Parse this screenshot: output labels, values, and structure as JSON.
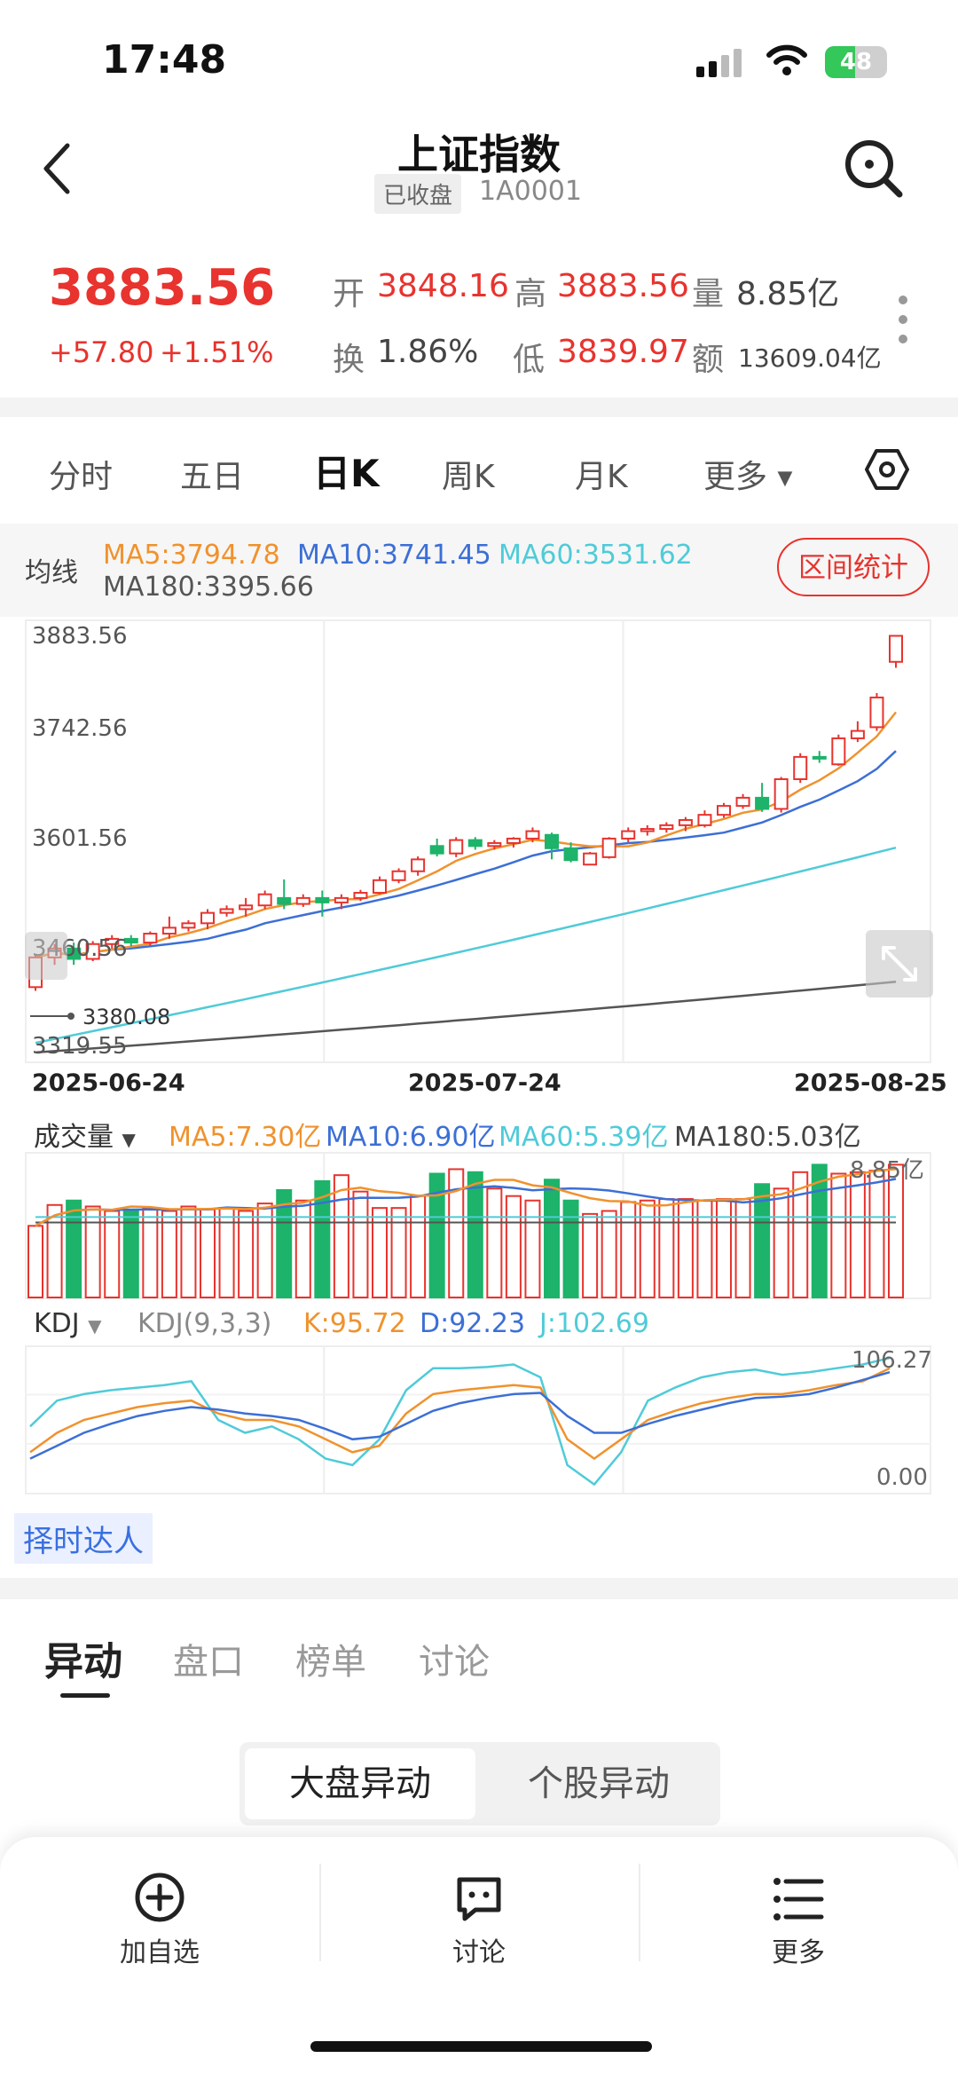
{
  "status_bar": {
    "time": "17:48",
    "battery": "48",
    "battery_level": 0.48
  },
  "header": {
    "title": "上证指数",
    "status": "已收盘",
    "code": "1A0001"
  },
  "quote": {
    "price": "3883.56",
    "change": "+57.80",
    "change_pct": "+1.51%",
    "open_label": "开",
    "open": "3848.16",
    "high_label": "高",
    "high": "3883.56",
    "volume_label": "量",
    "volume": "8.85亿",
    "turnover_label": "换",
    "turnover": "1.86%",
    "low_label": "低",
    "low": "3839.97",
    "amount_label": "额",
    "amount": "13609.04亿"
  },
  "chart_tabs": {
    "intraday": "分时",
    "five_day": "五日",
    "day_k": "日K",
    "week_k": "周K",
    "month_k": "月K",
    "more": "更多"
  },
  "ma_bar": {
    "label": "均线",
    "ma5": "MA5:3794.78",
    "ma10": "MA10:3741.45",
    "ma60": "MA60:3531.62",
    "ma180": "MA180:3395.66",
    "range_stats": "区间统计",
    "colors": {
      "ma5": "#f0922d",
      "ma10": "#3c6fd6",
      "ma60": "#4fcbd8",
      "ma180": "#555555"
    }
  },
  "volume_bar": {
    "label": "成交量",
    "ma5": "MA5:7.30亿",
    "ma10": "MA10:6.90亿",
    "ma60": "MA60:5.39亿",
    "ma180": "MA180:5.03亿",
    "last": "8.85亿"
  },
  "kdj_bar": {
    "label": "KDJ",
    "params": "KDJ(9,3,3)",
    "k": "K:95.72",
    "d": "D:92.23",
    "j": "J:102.69",
    "top": "106.27",
    "bottom": "0.00"
  },
  "badge": "择时达人",
  "bottom_tabs": [
    "异动",
    "盘口",
    "榜单",
    "讨论"
  ],
  "segment": {
    "left": "大盘异动",
    "right": "个股异动"
  },
  "bottom_bar": {
    "add": "加自选",
    "discuss": "讨论",
    "more": "更多"
  },
  "chart_data": {
    "type": "candlestick",
    "y_ticks": [
      "3883.56",
      "3742.56",
      "3601.56",
      "3460.56",
      "3319.55"
    ],
    "ylim": [
      3319.55,
      3883.56
    ],
    "low_marker": "3380.08",
    "x_labels": [
      "2025-06-24",
      "2025-07-24",
      "2025-08-25"
    ],
    "candles": [
      [
        3410,
        3450,
        3405,
        3455
      ],
      [
        3450,
        3462,
        3440,
        3468
      ],
      [
        3462,
        3448,
        3440,
        3470
      ],
      [
        3448,
        3468,
        3445,
        3472
      ],
      [
        3468,
        3475,
        3462,
        3480
      ],
      [
        3475,
        3470,
        3465,
        3480
      ],
      [
        3470,
        3482,
        3466,
        3485
      ],
      [
        3482,
        3490,
        3475,
        3505
      ],
      [
        3490,
        3496,
        3485,
        3500
      ],
      [
        3496,
        3510,
        3488,
        3515
      ],
      [
        3510,
        3515,
        3505,
        3520
      ],
      [
        3515,
        3520,
        3505,
        3530
      ],
      [
        3520,
        3535,
        3515,
        3540
      ],
      [
        3530,
        3522,
        3515,
        3555
      ],
      [
        3522,
        3530,
        3518,
        3535
      ],
      [
        3530,
        3524,
        3505,
        3540
      ],
      [
        3524,
        3530,
        3515,
        3535
      ],
      [
        3530,
        3537,
        3526,
        3541
      ],
      [
        3537,
        3554,
        3535,
        3559
      ],
      [
        3554,
        3566,
        3550,
        3570
      ],
      [
        3566,
        3582,
        3560,
        3586
      ],
      [
        3600,
        3590,
        3586,
        3610
      ],
      [
        3590,
        3608,
        3585,
        3612
      ],
      [
        3608,
        3600,
        3595,
        3612
      ],
      [
        3600,
        3604,
        3595,
        3608
      ],
      [
        3604,
        3610,
        3598,
        3612
      ],
      [
        3610,
        3620,
        3605,
        3625
      ],
      [
        3615,
        3597,
        3582,
        3618
      ],
      [
        3597,
        3581,
        3578,
        3605
      ],
      [
        3575,
        3590,
        3574,
        3592
      ],
      [
        3585,
        3610,
        3583,
        3612
      ],
      [
        3610,
        3620,
        3605,
        3625
      ],
      [
        3620,
        3623,
        3614,
        3628
      ],
      [
        3623,
        3628,
        3618,
        3632
      ],
      [
        3628,
        3635,
        3620,
        3639
      ],
      [
        3628,
        3642,
        3625,
        3648
      ],
      [
        3642,
        3654,
        3638,
        3658
      ],
      [
        3654,
        3665,
        3650,
        3670
      ],
      [
        3665,
        3650,
        3646,
        3685
      ],
      [
        3650,
        3690,
        3645,
        3693
      ],
      [
        3690,
        3720,
        3685,
        3725
      ],
      [
        3720,
        3718,
        3712,
        3728
      ],
      [
        3710,
        3745,
        3708,
        3750
      ],
      [
        3745,
        3755,
        3740,
        3768
      ],
      [
        3760,
        3800,
        3755,
        3806
      ],
      [
        3848,
        3883,
        3840,
        3883
      ]
    ],
    "volume": [
      4.8,
      6.2,
      6.5,
      6.1,
      5.8,
      5.9,
      6.0,
      5.8,
      6.1,
      5.9,
      6.0,
      5.8,
      6.3,
      7.2,
      6.5,
      7.8,
      8.2,
      7.1,
      6.0,
      6.0,
      6.8,
      8.3,
      8.6,
      8.4,
      7.3,
      6.8,
      6.5,
      7.9,
      6.5,
      5.6,
      5.8,
      6.4,
      6.5,
      6.6,
      6.6,
      6.5,
      6.6,
      6.6,
      7.6,
      7.3,
      8.4,
      8.9,
      8.3,
      8.4,
      8.5,
      8.9
    ],
    "kdj": {
      "k": [
        30,
        45,
        55,
        60,
        65,
        68,
        70,
        60,
        55,
        55,
        50,
        40,
        30,
        35,
        60,
        75,
        78,
        80,
        82,
        80,
        40,
        25,
        40,
        55,
        62,
        68,
        72,
        75,
        75,
        78,
        82,
        85,
        95
      ],
      "d": [
        25,
        35,
        45,
        52,
        58,
        62,
        65,
        63,
        60,
        58,
        55,
        48,
        40,
        42,
        52,
        62,
        68,
        72,
        75,
        76,
        58,
        45,
        45,
        52,
        58,
        63,
        68,
        72,
        73,
        75,
        80,
        86,
        92
      ],
      "j": [
        50,
        70,
        75,
        78,
        80,
        82,
        85,
        55,
        45,
        50,
        40,
        25,
        20,
        40,
        78,
        95,
        95,
        96,
        98,
        88,
        20,
        5,
        30,
        70,
        80,
        88,
        92,
        94,
        90,
        92,
        95,
        98,
        103
      ]
    }
  }
}
